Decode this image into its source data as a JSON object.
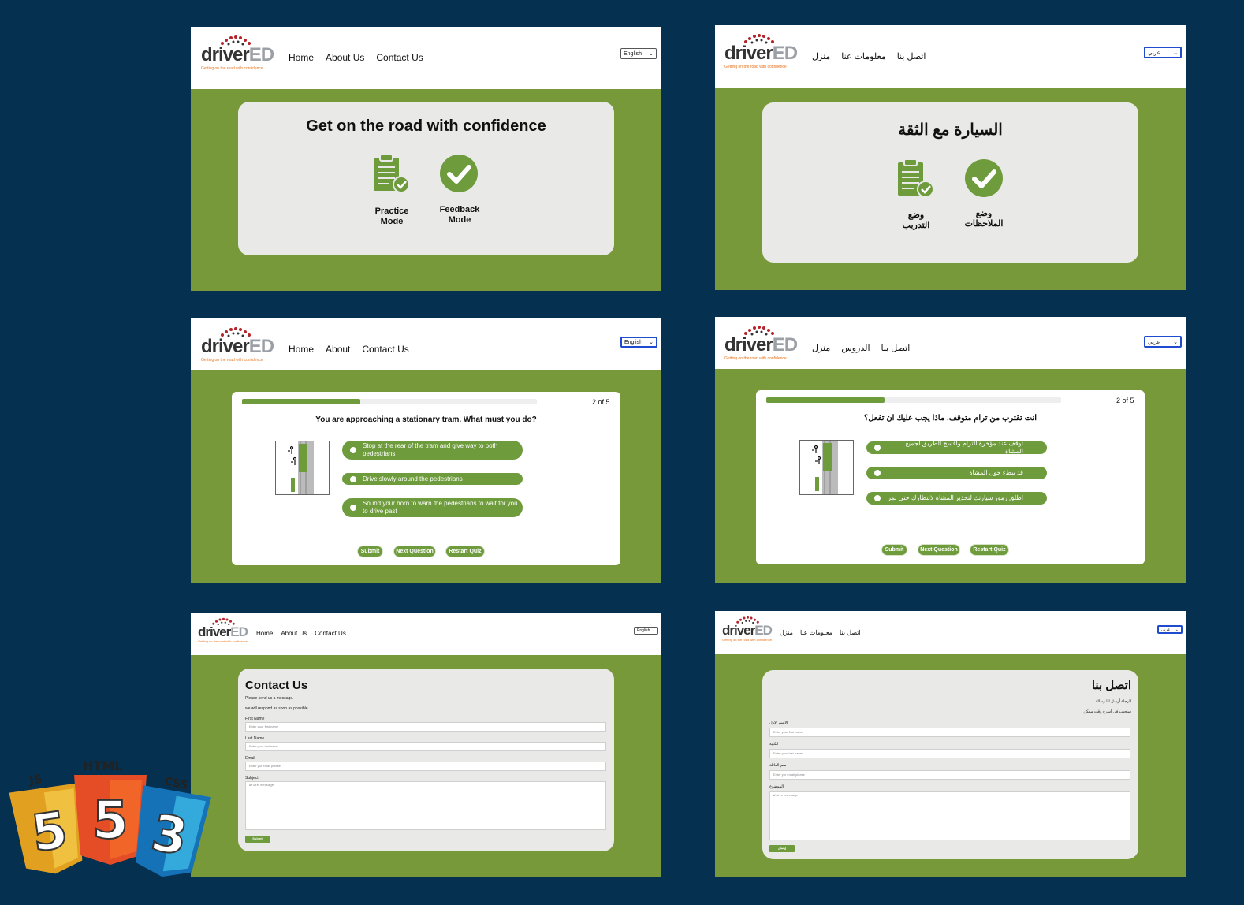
{
  "logo": {
    "word_main": "driver",
    "word_ed": "ED",
    "tagline": "Getting on the road with confidence"
  },
  "nav_en": {
    "home": "Home",
    "about_us": "About Us",
    "contact": "Contact Us",
    "about": "About"
  },
  "nav_ar": {
    "home": "منزل",
    "about_us": "معلومات عنا",
    "contact": "اتصل بنا",
    "lessons": "الدروس"
  },
  "lang": {
    "en": "English",
    "ar": "عربي"
  },
  "home_en": {
    "title": "Get on the road with confidence",
    "practice_line1": "Practice",
    "practice_line2": "Mode",
    "feedback_line1": "Feedback",
    "feedback_line2": "Mode"
  },
  "home_ar": {
    "title": "السيارة مع الثقة",
    "practice_line1": "وضع",
    "practice_line2": "التدريب",
    "feedback_line1": "وضع",
    "feedback_line2": "الملاحظات"
  },
  "quiz_en": {
    "progress_fraction": 0.4,
    "count": "2 of 5",
    "question": "You are approaching a stationary tram. What must you do?",
    "options": [
      "Stop at the rear of the tram and give way to both pedestrians",
      "Drive slowly around the pedestrians",
      "Sound your horn to warn the pedestrians to wait for you to drive past"
    ],
    "submit": "Submit",
    "next": "Next Question",
    "restart": "Restart Quiz"
  },
  "quiz_ar": {
    "progress_fraction": 0.4,
    "count": "2 of 5",
    "question": "انت تقترب من ترام متوقف. ماذا يجب عليك ان تفعل؟",
    "options": [
      "توقف عند مؤخرة الترام وافسح الطريق لجميع المشاة",
      "قد ببطء حول المشاة",
      "اطلق زمور سيارتك لتحذير المشاة لانتظارك حتى تمر"
    ],
    "submit": "Submit",
    "next": "Next Question",
    "restart": "Restart Quiz"
  },
  "contact_en": {
    "title": "Contact Us",
    "line1": "Please send us a message.",
    "line2": "we will respond as soon as possible",
    "first_label": "First Name",
    "first_ph": "Enter your first name",
    "last_label": "Last Name",
    "last_ph": "Enter your last name",
    "email_label": "Email",
    "email_ph": "Enter yor email please",
    "subject_label": "Subject",
    "subject_ph": "Write message",
    "submit": "Submit"
  },
  "contact_ar": {
    "title": "اتصل بنا",
    "line1": "الرجاء أرسل لنا رسالة",
    "line2": "سنجيب في أسرع وقت ممكن",
    "first_label": "الاسم الاول",
    "first_ph": "Enter your first name",
    "last_label": "الكنية",
    "last_ph": "Enter your last name",
    "email_label": "سم العائلة",
    "email_ph": "Enter yor email please",
    "subject_label": "الموضوع",
    "subject_ph": "Write message",
    "submit": "إرسال"
  },
  "badges": {
    "js": "JS",
    "html": "HTML",
    "css": "CSS",
    "js_num": "5",
    "html_num": "5",
    "css_num": "3"
  },
  "colors": {
    "background": "#06304f",
    "green": "#77993a",
    "button_green": "#6e9b3c",
    "card_gray": "#e9eae8",
    "accent_orange": "#e8741e"
  }
}
